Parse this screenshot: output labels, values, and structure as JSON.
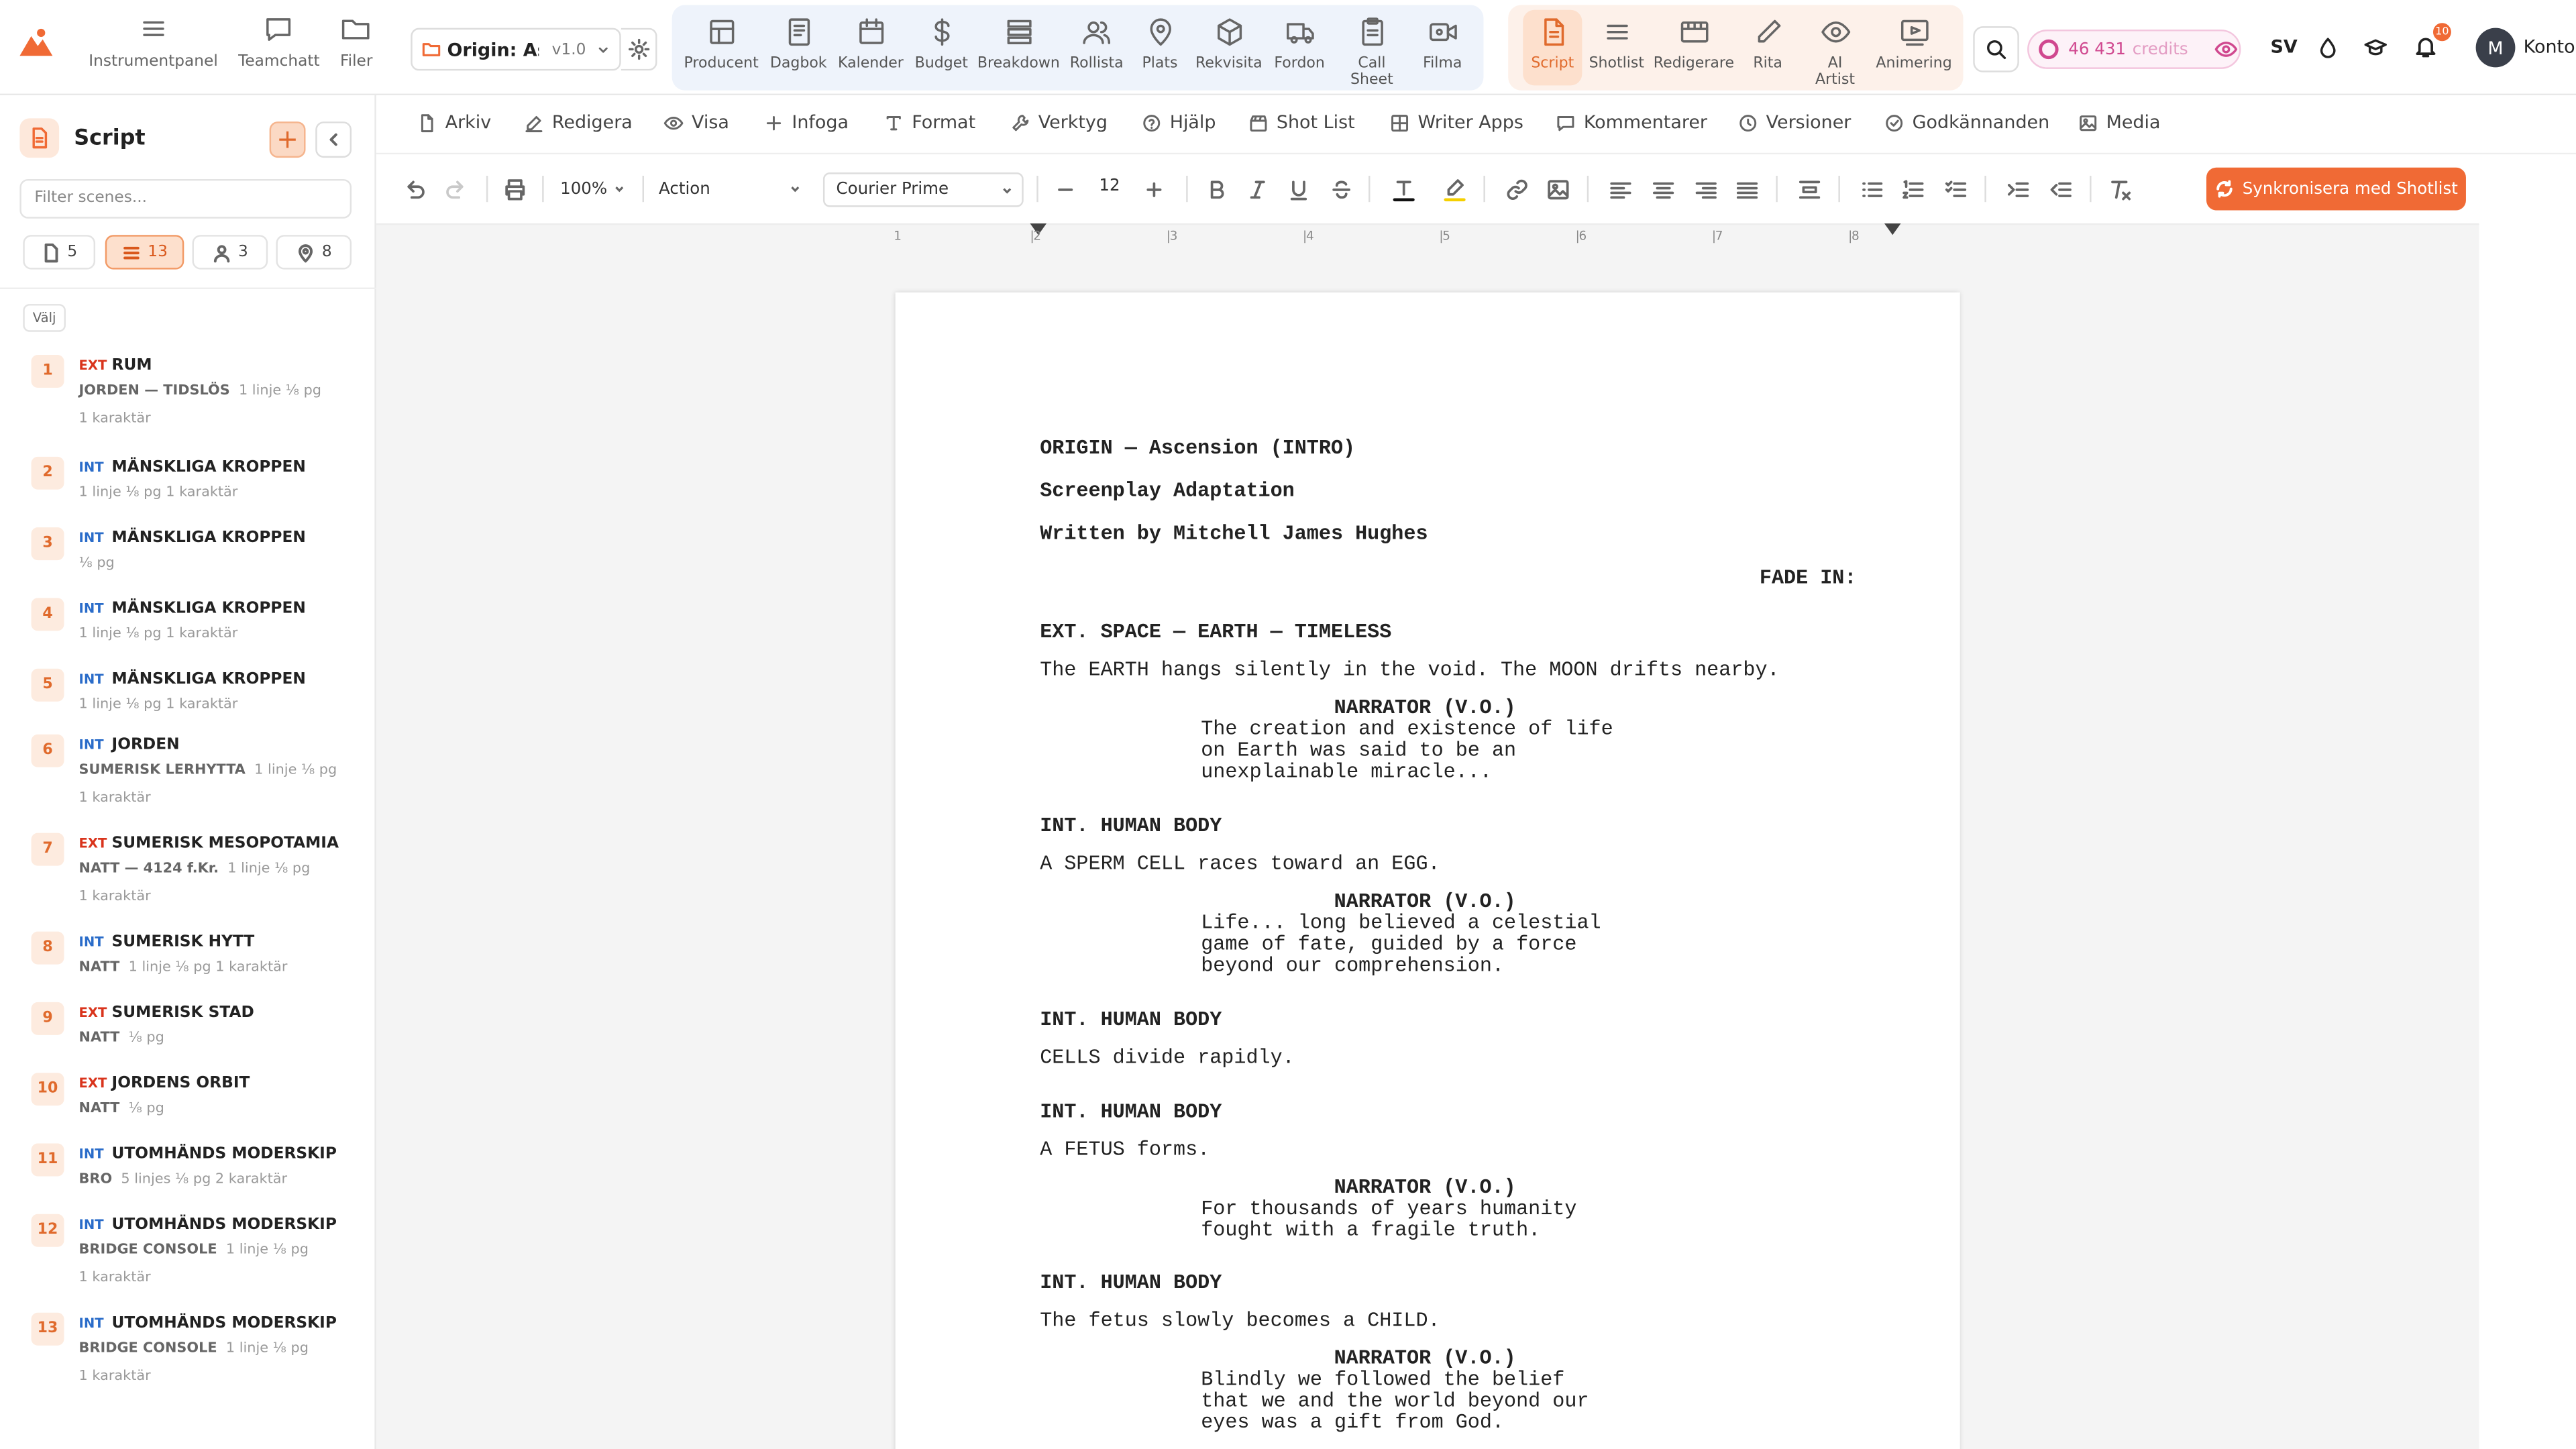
{
  "nav": {
    "items": [
      {
        "label": "Instrumentpanel",
        "icon": "menu-icon"
      },
      {
        "label": "Teamchatt",
        "icon": "chat-icon"
      },
      {
        "label": "Filer",
        "icon": "folder-icon"
      }
    ]
  },
  "project": {
    "name": "Origin: As...",
    "version": "v1.0"
  },
  "modules_production": [
    {
      "label": "Producent",
      "icon": "dashboard-icon"
    },
    {
      "label": "Dagbok",
      "icon": "book-icon"
    },
    {
      "label": "Kalender",
      "icon": "calendar-icon"
    },
    {
      "label": "Budget",
      "icon": "dollar-icon"
    },
    {
      "label": "Breakdown",
      "icon": "layers-icon"
    },
    {
      "label": "Rollista",
      "icon": "users-icon"
    },
    {
      "label": "Plats",
      "icon": "map-pin-icon"
    },
    {
      "label": "Rekvisita",
      "icon": "box-icon"
    },
    {
      "label": "Fordon",
      "icon": "truck-icon"
    },
    {
      "label": "Call",
      "label2": "Sheet",
      "icon": "clipboard-icon"
    },
    {
      "label": "Filma",
      "icon": "video-icon"
    }
  ],
  "modules_creative": [
    {
      "label": "Script",
      "icon": "script-icon"
    },
    {
      "label": "Shotlist",
      "icon": "list-icon"
    },
    {
      "label": "Redigerare",
      "icon": "film-editor-icon"
    },
    {
      "label": "Rita",
      "icon": "pencil-icon"
    },
    {
      "label": "AI",
      "label2": "Artist",
      "icon": "eye-icon"
    },
    {
      "label": "Animering",
      "icon": "animation-icon"
    }
  ],
  "credits": {
    "amount": "46 431",
    "label": "credits"
  },
  "language": "SV",
  "notifications_count": "10",
  "account": {
    "initial": "M",
    "label": "Konto"
  },
  "sidebar": {
    "title": "Script",
    "filter_placeholder": "Filter scenes...",
    "stats": {
      "pages": "5",
      "scenes": "13",
      "characters": "3",
      "locations": "8"
    },
    "select_label": "Välj",
    "scenes": [
      {
        "num": "1",
        "type": "EXT",
        "title": "RUM",
        "line1": "JORDEN — TIDSLÖS",
        "line1_extra": "1 linje  ⅛ pg",
        "line2": "1 karaktär"
      },
      {
        "num": "2",
        "type": "INT",
        "title": "MÄNSKLIGA KROPPEN",
        "line1": "",
        "line1_extra": "1 linje  ⅛ pg  1 karaktär",
        "line2": ""
      },
      {
        "num": "3",
        "type": "INT",
        "title": "MÄNSKLIGA KROPPEN",
        "line1": "",
        "line1_extra": "⅛ pg",
        "line2": ""
      },
      {
        "num": "4",
        "type": "INT",
        "title": "MÄNSKLIGA KROPPEN",
        "line1": "",
        "line1_extra": "1 linje  ⅛ pg  1 karaktär",
        "line2": ""
      },
      {
        "num": "5",
        "type": "INT",
        "title": "MÄNSKLIGA KROPPEN",
        "line1": "",
        "line1_extra": "1 linje  ⅛ pg  1 karaktär",
        "line2": ""
      },
      {
        "num": "6",
        "type": "INT",
        "title": "JORDEN",
        "line1": "SUMERISK LERHYTTA",
        "line1_extra": "1 linje  ⅛ pg",
        "line2": "1 karaktär"
      },
      {
        "num": "7",
        "type": "EXT",
        "title": "SUMERISK MESOPOTAMIA",
        "line1": "NATT — 4124 f.Kr.",
        "line1_extra": "1 linje  ⅛ pg",
        "line2": "1 karaktär"
      },
      {
        "num": "8",
        "type": "INT",
        "title": "SUMERISK HYTT",
        "line1": "NATT",
        "line1_extra": "1 linje  ⅛ pg  1 karaktär",
        "line2": ""
      },
      {
        "num": "9",
        "type": "EXT",
        "title": "SUMERISK STAD",
        "line1": "NATT",
        "line1_extra": "⅛ pg",
        "line2": ""
      },
      {
        "num": "10",
        "type": "EXT",
        "title": "JORDENS ORBIT",
        "line1": "NATT",
        "line1_extra": "⅛ pg",
        "line2": ""
      },
      {
        "num": "11",
        "type": "INT",
        "title": "UTOMHÄNDS MODERSKIP",
        "line1": "BRO",
        "line1_extra": "5 linjes  ⅛ pg  2 karaktär",
        "line2": ""
      },
      {
        "num": "12",
        "type": "INT",
        "title": "UTOMHÄNDS MODERSKIP",
        "line1": "BRIDGE CONSOLE",
        "line1_extra": "1 linje  ⅛ pg",
        "line2": "1 karaktär"
      },
      {
        "num": "13",
        "type": "INT",
        "title": "UTOMHÄNDS MODERSKIP",
        "line1": "BRIDGE CONSOLE",
        "line1_extra": "1 linje  ⅛ pg",
        "line2": "1 karaktär"
      }
    ]
  },
  "menubar": [
    {
      "label": "Arkiv",
      "icon": "file-icon"
    },
    {
      "label": "Redigera",
      "icon": "edit-icon"
    },
    {
      "label": "Visa",
      "icon": "eye-icon"
    },
    {
      "label": "Infoga",
      "icon": "plus-icon"
    },
    {
      "label": "Format",
      "icon": "type-icon"
    },
    {
      "label": "Verktyg",
      "icon": "wrench-icon"
    },
    {
      "label": "Hjälp",
      "icon": "help-icon"
    },
    {
      "label": "Shot List",
      "icon": "clapper-icon"
    },
    {
      "label": "Writer Apps",
      "icon": "grid-icon"
    },
    {
      "label": "Kommentarer",
      "icon": "comment-icon"
    },
    {
      "label": "Versioner",
      "icon": "clock-icon"
    },
    {
      "label": "Godkännanden",
      "icon": "check-circle-icon"
    },
    {
      "label": "Media",
      "icon": "image-icon"
    }
  ],
  "format": {
    "zoom": "100%",
    "element": "Action",
    "font": "Courier Prime",
    "size": "12",
    "sync_label": "Synkronisera med Shotlist"
  },
  "ruler": [
    "1",
    "2",
    "3",
    "4",
    "5",
    "6",
    "7",
    "8"
  ],
  "script_lines": [
    {
      "text": "ORIGIN — Ascension (INTRO)",
      "style": "b"
    },
    {
      "text": "Screenplay Adaptation",
      "style": "b"
    },
    {
      "text": "Written by Mitchell James Hughes",
      "style": "b"
    },
    {
      "text": "FADE IN:",
      "style": "b"
    },
    {
      "text": "EXT. SPACE — EARTH — TIMELESS",
      "style": "b"
    },
    {
      "text": "The EARTH hangs silently in the void. The MOON drifts nearby.",
      "style": ""
    },
    {
      "text": "NARRATOR (V.O.)",
      "style": "b"
    },
    {
      "text": "The creation and existence of life",
      "style": ""
    },
    {
      "text": "on Earth was said to be an",
      "style": ""
    },
    {
      "text": "unexplainable miracle...",
      "style": ""
    },
    {
      "text": "INT. HUMAN BODY",
      "style": "b"
    },
    {
      "text": "A SPERM CELL races toward an EGG.",
      "style": ""
    },
    {
      "text": "NARRATOR (V.O.)",
      "style": "b"
    },
    {
      "text": "Life... long believed a celestial",
      "style": ""
    },
    {
      "text": "game of fate, guided by a force",
      "style": ""
    },
    {
      "text": "beyond our comprehension.",
      "style": ""
    },
    {
      "text": "INT. HUMAN BODY",
      "style": "b"
    },
    {
      "text": "CELLS divide rapidly.",
      "style": ""
    },
    {
      "text": "INT. HUMAN BODY",
      "style": "b"
    },
    {
      "text": "A FETUS forms.",
      "style": ""
    },
    {
      "text": "NARRATOR (V.O.)",
      "style": "b"
    },
    {
      "text": "For thousands of years humanity",
      "style": ""
    },
    {
      "text": "fought with a fragile truth.",
      "style": ""
    },
    {
      "text": "INT. HUMAN BODY",
      "style": "b"
    },
    {
      "text": "The fetus slowly becomes a CHILD.",
      "style": ""
    },
    {
      "text": "NARRATOR (V.O.)",
      "style": "b"
    },
    {
      "text": "Blindly we followed the belief",
      "style": ""
    },
    {
      "text": "that we and the world beyond our",
      "style": ""
    },
    {
      "text": "eyes was a gift from God.",
      "style": ""
    }
  ]
}
